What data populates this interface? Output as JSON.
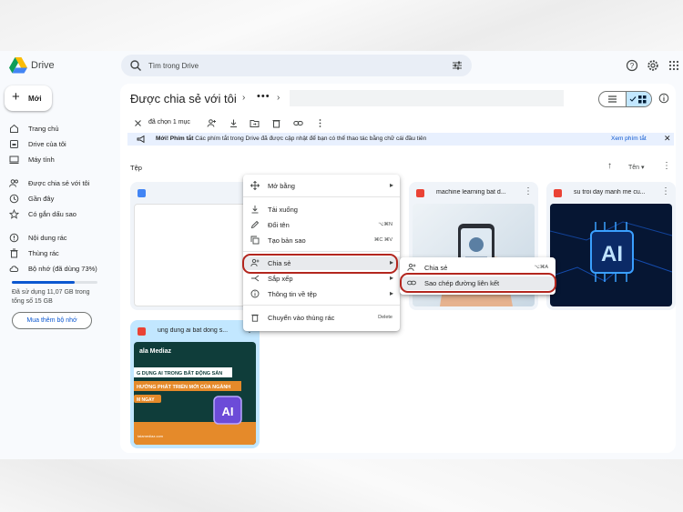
{
  "app": {
    "name": "Drive"
  },
  "search": {
    "placeholder": "Tìm trong Drive"
  },
  "sidebar": {
    "new_label": "Mới",
    "items": [
      {
        "label": "Trang chủ",
        "icon": "home-icon"
      },
      {
        "label": "Drive của tôi",
        "icon": "my-drive-icon"
      },
      {
        "label": "Máy tính",
        "icon": "computer-icon"
      },
      {
        "label": "Được chia sẻ với tôi",
        "icon": "shared-icon"
      },
      {
        "label": "Gần đây",
        "icon": "clock-icon"
      },
      {
        "label": "Có gắn dấu sao",
        "icon": "star-icon"
      },
      {
        "label": "Nội dung rác",
        "icon": "spam-icon"
      },
      {
        "label": "Thùng rác",
        "icon": "trash-icon"
      },
      {
        "label": "Bộ nhớ (đã dùng 73%)",
        "icon": "cloud-icon"
      }
    ],
    "storage_percent": 73,
    "storage_text": "Đã sử dụng 11,07 GB trong tổng số 15 GB",
    "buy_label": "Mua thêm bộ nhớ"
  },
  "main": {
    "breadcrumb": "Được chia sẻ với tôi",
    "selection_count": "đã chọn 1 mục",
    "banner": {
      "bold": "Mới! Phím tắt",
      "text": "Các phím tắt trong Drive đã được cập nhật để bạn có thể thao tác bằng chữ cái đầu tiên",
      "link": "Xem phím tắt"
    },
    "section_title": "Tệp",
    "sort_label": "Tên",
    "files": [
      {
        "name": "",
        "type": "doc"
      },
      {
        "name": "machine learning bat d...",
        "type": "image"
      },
      {
        "name": "su troi day manh me cu...",
        "type": "image"
      },
      {
        "name": "ung dung ai bat dong s...",
        "type": "image"
      }
    ]
  },
  "context_menu": {
    "items": [
      {
        "label": "Mở bằng",
        "shortcut": "",
        "icon": "open-with-icon"
      },
      {
        "label": "Tải xuống",
        "shortcut": "",
        "icon": "download-icon"
      },
      {
        "label": "Đổi tên",
        "shortcut": "⌥⌘N",
        "icon": "rename-icon"
      },
      {
        "label": "Tạo bản sao",
        "shortcut": "⌘C ⌘V",
        "icon": "copy-icon"
      },
      {
        "label": "Chia sẻ",
        "shortcut": "",
        "icon": "share-icon"
      },
      {
        "label": "Sắp xếp",
        "shortcut": "",
        "icon": "organize-icon"
      },
      {
        "label": "Thông tin về tệp",
        "shortcut": "",
        "icon": "info-icon"
      },
      {
        "label": "Chuyển vào thùng rác",
        "shortcut": "Delete",
        "icon": "trash-icon"
      }
    ],
    "submenu": [
      {
        "label": "Chia sẻ",
        "shortcut": "⌥⌘A"
      },
      {
        "label": "Sao chép đường liên kết",
        "shortcut": ""
      }
    ]
  },
  "thumbs": {
    "promo_brand": "ala Mediaz",
    "promo_line1": "G DỤNG AI TRONG BẤT ĐỘNG SẢN",
    "promo_line2": "HƯỚNG PHÁT TRIỂN MỚI CỦA NGÀNH",
    "promo_btn": "M NGAY",
    "promo_ai": "AI",
    "promo_footer": "talamediaz.com",
    "ai_text": "AI"
  },
  "colors": {
    "accent": "#0b57d0",
    "selected": "#c2e7ff",
    "highlight": "#b3261e"
  }
}
